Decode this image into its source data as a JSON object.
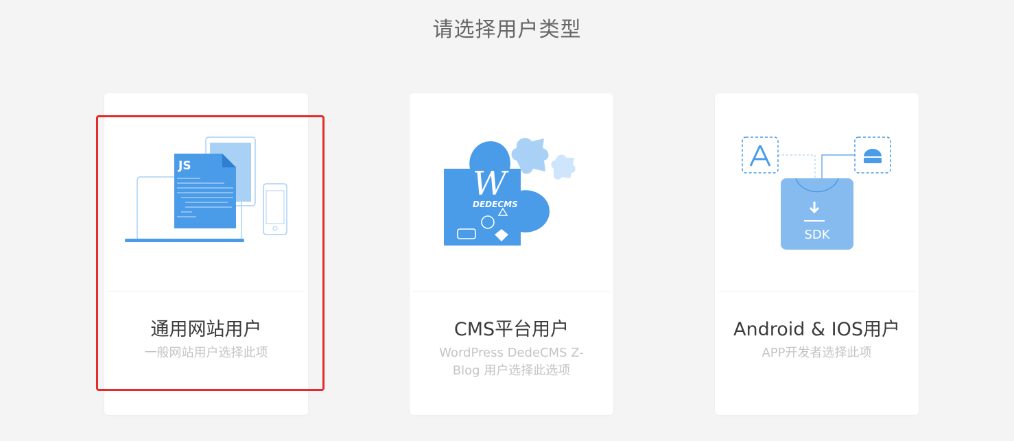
{
  "page": {
    "title": "请选择用户类型"
  },
  "cards": [
    {
      "title": "通用网站用户",
      "desc": "一般网站用户选择此项",
      "selected": true,
      "illustration": "web-devices-js-illustration"
    },
    {
      "title": "CMS平台用户",
      "desc": "WordPress DedeCMS Z- Blog 用户选择此选项",
      "selected": false,
      "illustration": "cms-puzzle-illustration"
    },
    {
      "title": "Android & IOS用户",
      "desc": "APP开发者选择此项",
      "selected": false,
      "illustration": "sdk-appstore-android-illustration"
    }
  ],
  "illustrations": {
    "js_badge": "JS",
    "cms_brand": "DEDECMS",
    "sdk_label": "SDK"
  },
  "colors": {
    "accent": "#4a9be8",
    "light_accent": "#a9d0f5",
    "selection_border": "#e52a2a"
  }
}
